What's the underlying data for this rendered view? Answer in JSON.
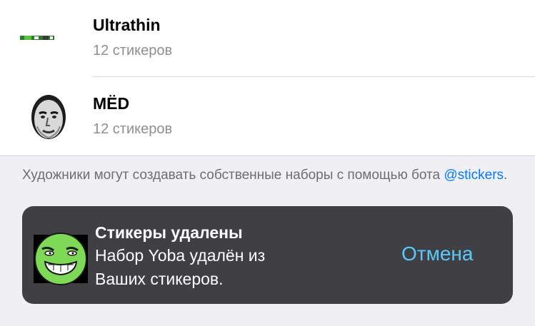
{
  "sticker_sets": [
    {
      "title": "Ultrathin",
      "count": "12 стикеров",
      "thumb_icon": "ultrathin-sticker-thumbnail"
    },
    {
      "title": "MЁD",
      "count": "12 стикеров",
      "thumb_icon": "med-face-sticker-thumbnail"
    }
  ],
  "footer": {
    "text": "Художники могут создавать собственные наборы с помощью бота ",
    "link": "@stickers",
    "text_end": "."
  },
  "toast": {
    "title": "Стикеры удалены",
    "line1": "Набор Yoba удалён из",
    "line2": "Ваших стикеров.",
    "action": "Отмена",
    "icon": "yoba-face-sticker"
  },
  "colors": {
    "background": "#efeff4",
    "link": "#007aff",
    "toast_bg": "#404044",
    "toast_action": "#5ac8fa",
    "yoba_green": "#7ed956"
  }
}
